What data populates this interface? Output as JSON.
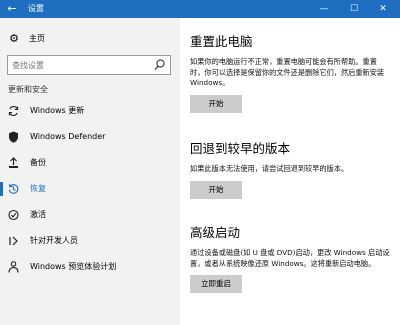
{
  "window": {
    "title": "设置",
    "back_glyph": "←",
    "minimize_glyph": "—",
    "maximize_glyph": "☐",
    "close_glyph": "✕"
  },
  "sidebar": {
    "home_label": "主页",
    "search_placeholder": "查找设置",
    "section_title": "更新和安全",
    "items": [
      {
        "label": "Windows 更新",
        "icon": "sync-icon"
      },
      {
        "label": "Windows Defender",
        "icon": "shield-icon"
      },
      {
        "label": "备份",
        "icon": "backup-icon"
      },
      {
        "label": "恢复",
        "icon": "recovery-icon",
        "active": true
      },
      {
        "label": "激活",
        "icon": "activation-icon"
      },
      {
        "label": "针对开发人员",
        "icon": "developer-icon"
      },
      {
        "label": "Windows 预览体验计划",
        "icon": "insider-icon"
      }
    ]
  },
  "main": {
    "reset": {
      "title": "重置此电脑",
      "description": "如果你的电脑运行不正常，重置电脑可能会有所帮助。重置时，你可以选择是保留你的文件还是删除它们，然后重新安装 Windows。",
      "button_label": "开始"
    },
    "goback": {
      "title": "回退到较早的版本",
      "description": "如果此版本无法使用，请尝试回退到较早的版本。",
      "button_label": "开始"
    },
    "advanced": {
      "title": "高级启动",
      "description": "通过设备或磁盘(如 U 盘或 DVD)启动，更改 Windows 启动设置，或者从系统映像还原 Windows。这将重新启动电脑。",
      "button_label": "立即重启"
    }
  },
  "colors": {
    "accent": "#1e6fbf",
    "sidebar_bg": "#f2f2f2",
    "button_bg": "#cccccc"
  }
}
